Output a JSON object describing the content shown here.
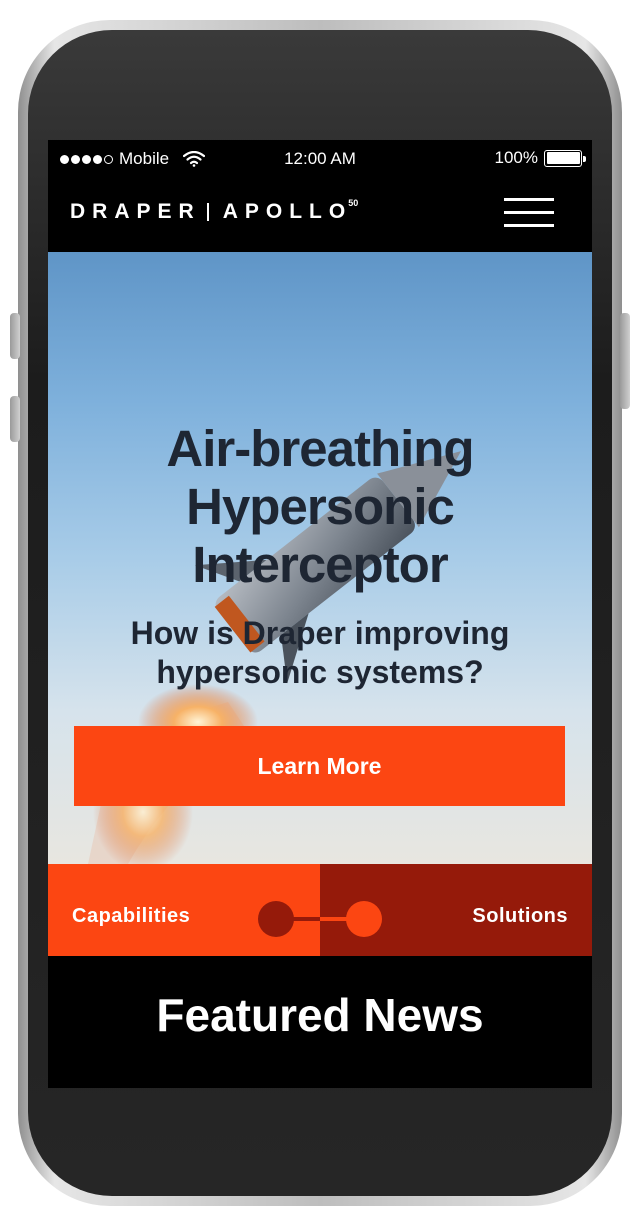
{
  "status_bar": {
    "carrier": "Mobile",
    "time": "12:00 AM",
    "battery": "100%"
  },
  "header": {
    "logo_left": "DRAPER",
    "logo_right": "APOLLO",
    "logo_sup": "50"
  },
  "hero": {
    "title_line1": "Air-breathing",
    "title_line2": "Hypersonic",
    "title_line3": "Interceptor",
    "subtitle_line1": "How is Draper improving",
    "subtitle_line2": "hypersonic systems?",
    "cta_label": "Learn More"
  },
  "split_nav": {
    "left_label": "Capabilities",
    "right_label": "Solutions",
    "left_color": "#fc4612",
    "right_color": "#951a0a"
  },
  "featured": {
    "title": "Featured News"
  },
  "colors": {
    "accent": "#fc4612",
    "dark_red": "#951a0a",
    "text_dark": "#1e2633"
  }
}
